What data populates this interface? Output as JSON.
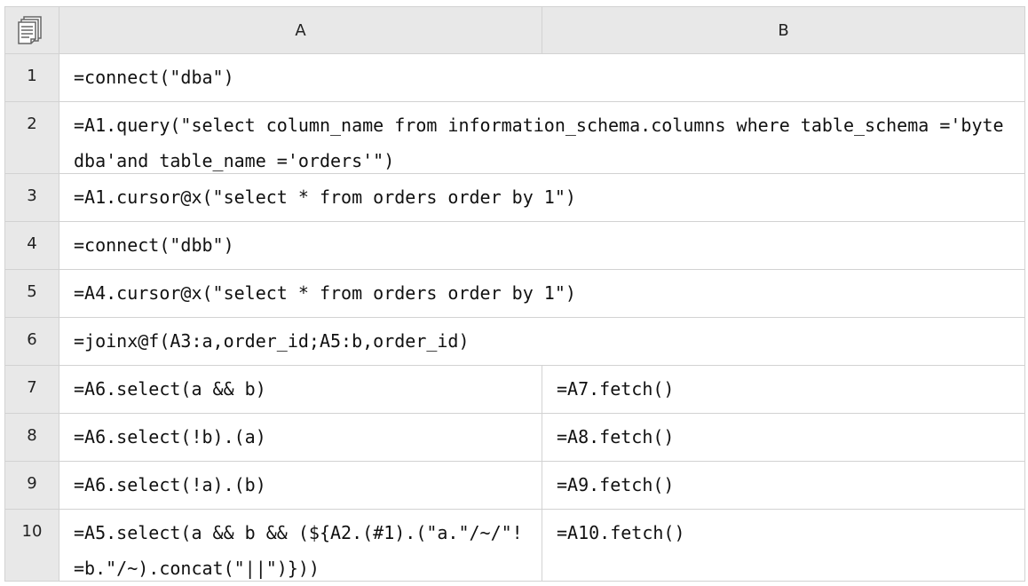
{
  "sheet": {
    "columns": [
      "A",
      "B"
    ],
    "rows": [
      {
        "num": "1",
        "a": "=connect(\"dba\")",
        "b": ""
      },
      {
        "num": "2",
        "a": "=A1.query(\"select column_name from information_schema.columns where table_schema ='bytedba'and table_name ='orders'\")",
        "b": ""
      },
      {
        "num": "3",
        "a": "=A1.cursor@x(\"select * from orders order by 1\")",
        "b": ""
      },
      {
        "num": "4",
        "a": "=connect(\"dbb\")",
        "b": ""
      },
      {
        "num": "5",
        "a": "=A4.cursor@x(\"select * from orders order by 1\")",
        "b": ""
      },
      {
        "num": "6",
        "a": "=joinx@f(A3:a,order_id;A5:b,order_id)",
        "b": ""
      },
      {
        "num": "7",
        "a": "=A6.select(a && b)",
        "b": "=A7.fetch()"
      },
      {
        "num": "8",
        "a": "=A6.select(!b).(a)",
        "b": "=A8.fetch()"
      },
      {
        "num": "9",
        "a": "=A6.select(!a).(b)",
        "b": "=A9.fetch()"
      },
      {
        "num": "10",
        "a": "=A5.select(a && b && (${A2.(#1).(\"a.\"/~/\"!=b.\"/~).concat(\"||\")}))",
        "b": "=A10.fetch()"
      }
    ]
  },
  "icons": {
    "corner": "document-icon"
  }
}
